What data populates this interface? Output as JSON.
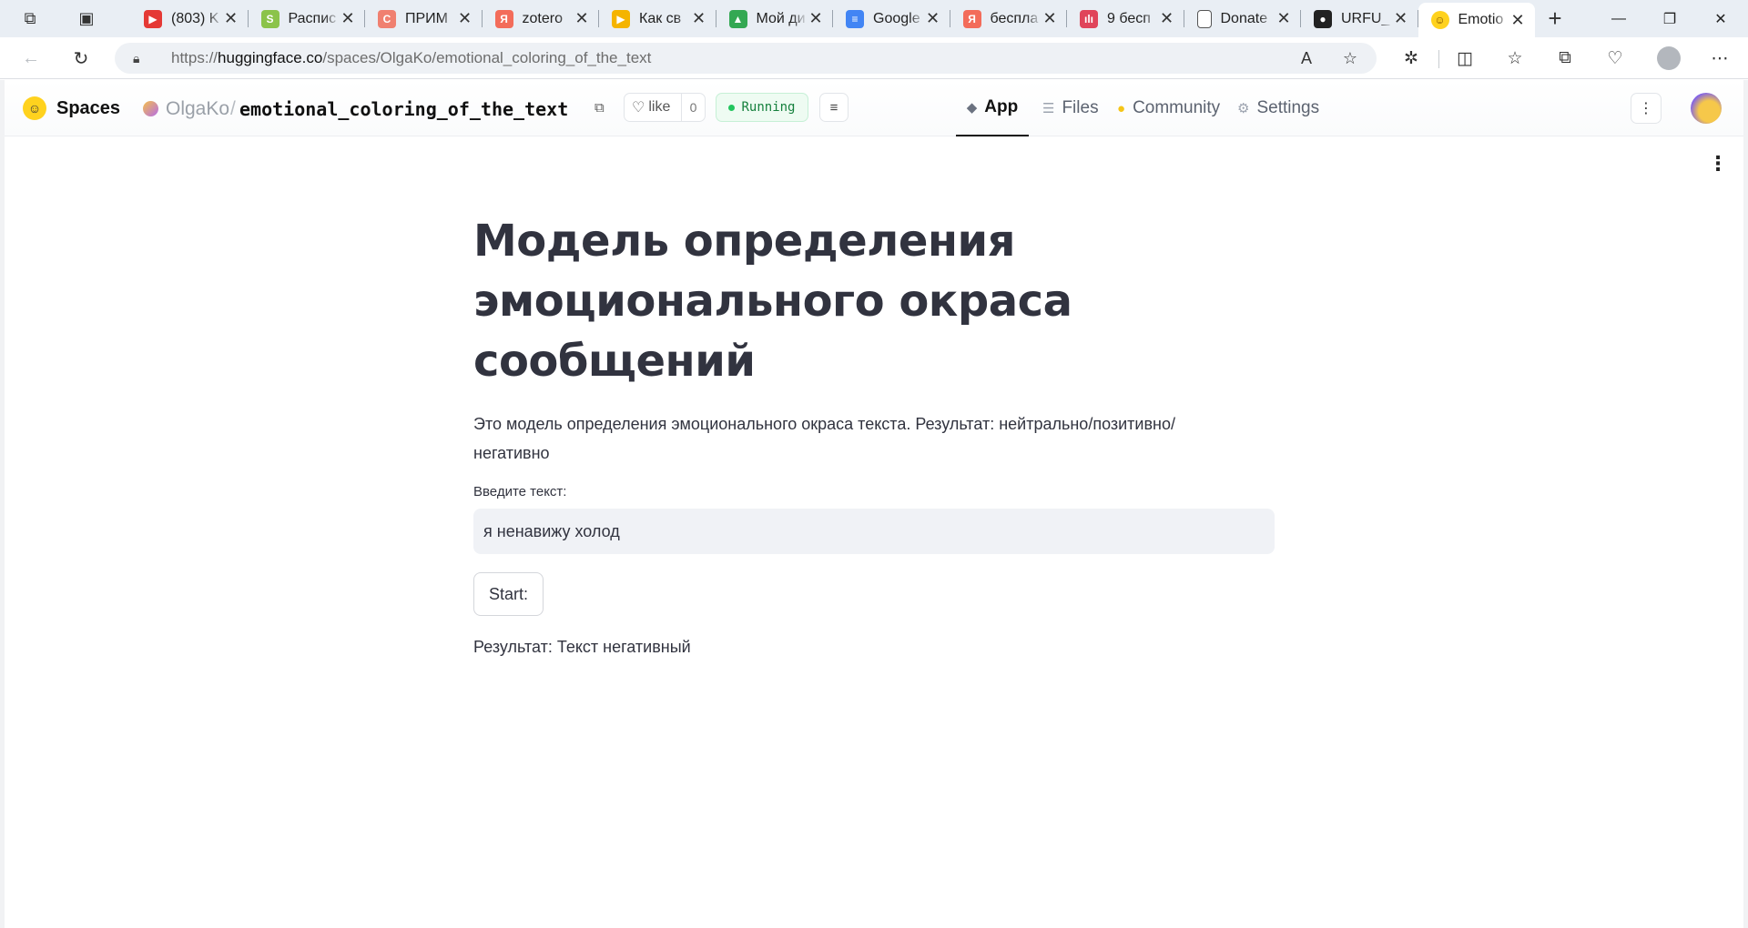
{
  "browser": {
    "tabs": [
      {
        "title": "(803) K",
        "favicon": "youtube-icon",
        "color": "#e53935",
        "glyph": "▶"
      },
      {
        "title": "Распис",
        "favicon": "sheets-icon",
        "color": "#8bc34a",
        "glyph": "S"
      },
      {
        "title": "ПРИМ",
        "favicon": "app-icon",
        "color": "#f08070",
        "glyph": "C"
      },
      {
        "title": "zotero",
        "favicon": "yandex-icon",
        "color": "#f36c5a",
        "glyph": "Я"
      },
      {
        "title": "Как св",
        "favicon": "video-icon",
        "color": "#f5b400",
        "glyph": "▶"
      },
      {
        "title": "Мой ди",
        "favicon": "drive-icon",
        "color": "#34a853",
        "glyph": "▲"
      },
      {
        "title": "Google",
        "favicon": "docs-icon",
        "color": "#4285f4",
        "glyph": "≡"
      },
      {
        "title": "беспла",
        "favicon": "yandex-icon",
        "color": "#f36c5a",
        "glyph": "Я"
      },
      {
        "title": "9 бесп",
        "favicon": "audio-icon",
        "color": "#e0445a",
        "glyph": "ılı"
      },
      {
        "title": "Donate",
        "favicon": "page-icon",
        "color": "#ffffff",
        "glyph": ""
      },
      {
        "title": "URFU_",
        "favicon": "github-icon",
        "color": "#222222",
        "glyph": "●"
      },
      {
        "title": "Emotio",
        "favicon": "huggingface-icon",
        "color": "#ffd21e",
        "glyph": "☺"
      }
    ],
    "url_prefix": "https://",
    "url_domain": "huggingface.co",
    "url_path": "/spaces/OlgaKo/emotional_coloring_of_the_text"
  },
  "hf": {
    "spaces_label": "Spaces",
    "owner": "OlgaKo",
    "separator": "/",
    "repo": "emotional_coloring_of_the_text",
    "like_label": "like",
    "like_count": "0",
    "status": "Running",
    "status_color": "#22c55e",
    "tabs": {
      "app": "App",
      "files": "Files",
      "community": "Community",
      "settings": "Settings"
    }
  },
  "app": {
    "title": "Модель определения эмоционального окраса сообщений",
    "description": "Это модель определения эмоционального окраса текста. Результат: нейтрально/позитивно/негативно",
    "input_label": "Введите текст:",
    "input_value": "я ненавижу холод",
    "button_label": "Start:",
    "result": "Результат: Текст негативный"
  }
}
